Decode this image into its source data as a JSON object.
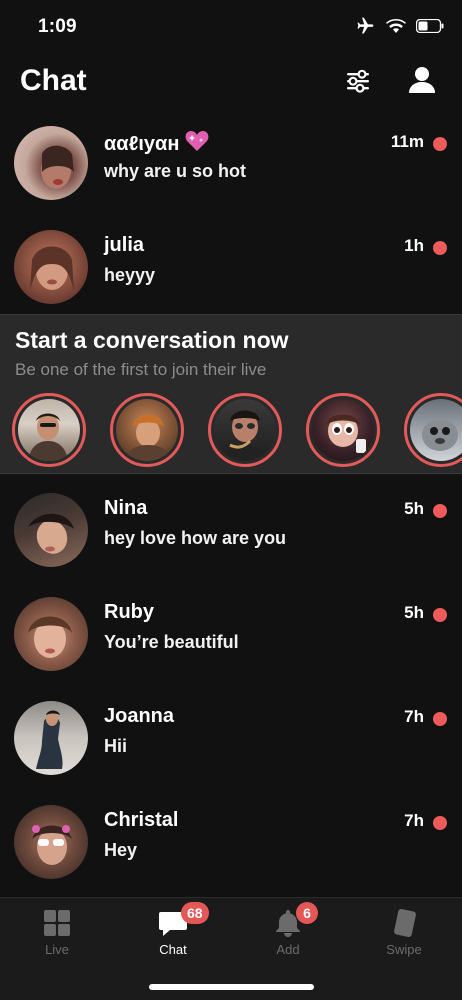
{
  "status_bar": {
    "time": "1:09"
  },
  "header": {
    "title": "Chat"
  },
  "chats_top": [
    {
      "name": "ααℓιуαн",
      "has_heart": true,
      "message": "why are u so hot",
      "time": "11m"
    },
    {
      "name": "julia",
      "has_heart": false,
      "message": "heyyy",
      "time": "1h"
    }
  ],
  "live": {
    "title": "Start a conversation now",
    "subtitle": "Be one of the first to join their live"
  },
  "chats_bottom": [
    {
      "name": "Nina",
      "message": "hey love how are you",
      "time": "5h"
    },
    {
      "name": "Ruby",
      "message": "You’re beautiful",
      "time": "5h"
    },
    {
      "name": "Joanna",
      "message": "Hii",
      "time": "7h"
    },
    {
      "name": "Christal",
      "message": "Hey",
      "time": "7h"
    }
  ],
  "tabs": [
    {
      "label": "Live",
      "icon": "grid-icon",
      "badge": ""
    },
    {
      "label": "Chat",
      "icon": "chat-bubble-icon",
      "badge": "68"
    },
    {
      "label": "Add",
      "icon": "bell-icon",
      "badge": "6"
    },
    {
      "label": "Swipe",
      "icon": "card-icon",
      "badge": ""
    }
  ],
  "colors": {
    "accent": "#ee5b5b",
    "background": "#111111",
    "live_strip": "#2a2a2a"
  }
}
